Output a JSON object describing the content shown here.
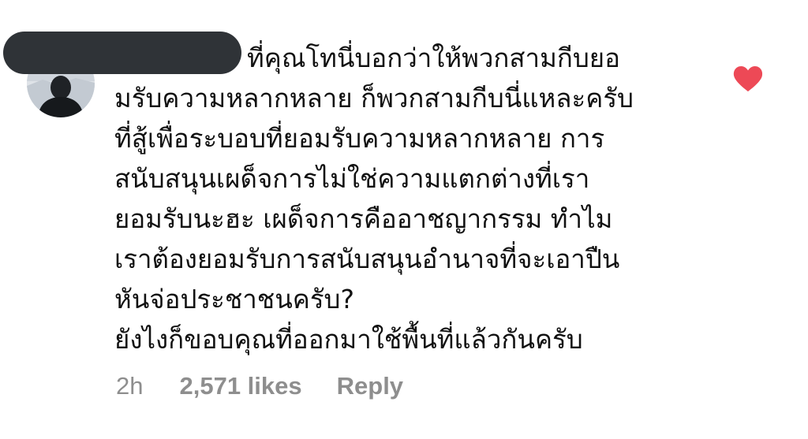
{
  "comment": {
    "avatar_icon": "user-avatar",
    "username_redacted": true,
    "text_lines": [
      "ที่คุณโทนี่บอกว่าให้พวกสามกีบยอ",
      "มรับความหลากหลาย ก็พวกสามกีบนี่แหละครับ",
      "ที่สู้เพื่อระบอบที่ยอมรับความหลากหลาย การ",
      "สนับสนุนเผด็จการไม่ใช่ความแตกต่างที่เรา",
      "ยอมรับนะฮะ เผด็จการคืออาชญากรรม ทำไม",
      "เราต้องยอมรับการสนับสนุนอำนาจที่จะเอาปืน",
      "หันจ่อประชาชนครับ?",
      "ยังไงก็ขอบคุณที่ออกมาใช้พื้นที่แล้วกันครับ"
    ],
    "time": "2h",
    "likes": "2,571 likes",
    "reply_label": "Reply",
    "liked": true,
    "heart_icon": "heart-icon",
    "colors": {
      "text": "#111111",
      "meta": "#8e8e8e",
      "heart": "#ed4956",
      "redaction": "#2f3337"
    }
  }
}
